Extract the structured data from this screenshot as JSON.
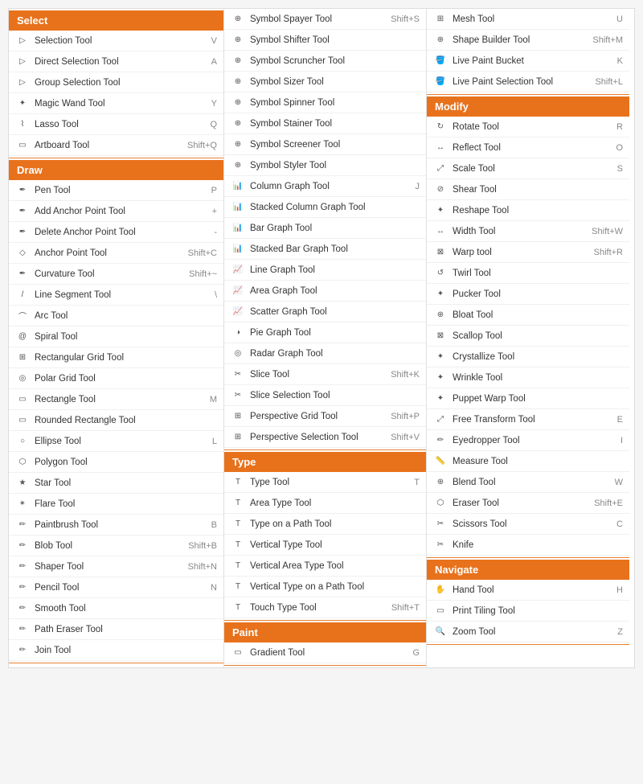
{
  "columns": [
    {
      "sections": [
        {
          "header": "Select",
          "tools": [
            {
              "name": "Selection Tool",
              "shortcut": "V",
              "icon": "▷"
            },
            {
              "name": "Direct Selection Tool",
              "shortcut": "A",
              "icon": "▷"
            },
            {
              "name": "Group Selection Tool",
              "shortcut": "",
              "icon": "▷"
            },
            {
              "name": "Magic Wand Tool",
              "shortcut": "Y",
              "icon": "✦"
            },
            {
              "name": "Lasso Tool",
              "shortcut": "Q",
              "icon": "⌇"
            },
            {
              "name": "Artboard Tool",
              "shortcut": "Shift+Q",
              "icon": "▭"
            }
          ]
        },
        {
          "header": "Draw",
          "tools": [
            {
              "name": "Pen Tool",
              "shortcut": "P",
              "icon": "✒"
            },
            {
              "name": "Add Anchor Point Tool",
              "shortcut": "+",
              "icon": "✒"
            },
            {
              "name": "Delete Anchor Point Tool",
              "shortcut": "-",
              "icon": "✒"
            },
            {
              "name": "Anchor Point Tool",
              "shortcut": "Shift+C",
              "icon": "◇"
            },
            {
              "name": "Curvature Tool",
              "shortcut": "Shift+~",
              "icon": "✒"
            },
            {
              "name": "Line Segment Tool",
              "shortcut": "\\",
              "icon": "/"
            },
            {
              "name": "Arc Tool",
              "shortcut": "",
              "icon": "⌒"
            },
            {
              "name": "Spiral Tool",
              "shortcut": "",
              "icon": "@"
            },
            {
              "name": "Rectangular Grid Tool",
              "shortcut": "",
              "icon": "⊞"
            },
            {
              "name": "Polar Grid Tool",
              "shortcut": "",
              "icon": "◎"
            },
            {
              "name": "Rectangle Tool",
              "shortcut": "M",
              "icon": "▭"
            },
            {
              "name": "Rounded Rectangle Tool",
              "shortcut": "",
              "icon": "▭"
            },
            {
              "name": "Ellipse Tool",
              "shortcut": "L",
              "icon": "○"
            },
            {
              "name": "Polygon Tool",
              "shortcut": "",
              "icon": "⬡"
            },
            {
              "name": "Star Tool",
              "shortcut": "",
              "icon": "★"
            },
            {
              "name": "Flare Tool",
              "shortcut": "",
              "icon": "✴"
            },
            {
              "name": "Paintbrush Tool",
              "shortcut": "B",
              "icon": "✏"
            },
            {
              "name": "Blob Tool",
              "shortcut": "Shift+B",
              "icon": "✏"
            },
            {
              "name": "Shaper Tool",
              "shortcut": "Shift+N",
              "icon": "✏"
            },
            {
              "name": "Pencil Tool",
              "shortcut": "N",
              "icon": "✏"
            },
            {
              "name": "Smooth Tool",
              "shortcut": "",
              "icon": "✏"
            },
            {
              "name": "Path Eraser Tool",
              "shortcut": "",
              "icon": "✏"
            },
            {
              "name": "Join Tool",
              "shortcut": "",
              "icon": "✏"
            }
          ]
        }
      ]
    },
    {
      "sections": [
        {
          "header": null,
          "tools": [
            {
              "name": "Symbol Spayer Tool",
              "shortcut": "Shift+S",
              "icon": "⊕"
            },
            {
              "name": "Symbol Shifter Tool",
              "shortcut": "",
              "icon": "⊕"
            },
            {
              "name": "Symbol Scruncher Tool",
              "shortcut": "",
              "icon": "⊕"
            },
            {
              "name": "Symbol Sizer Tool",
              "shortcut": "",
              "icon": "⊕"
            },
            {
              "name": "Symbol Spinner Tool",
              "shortcut": "",
              "icon": "⊕"
            },
            {
              "name": "Symbol Stainer Tool",
              "shortcut": "",
              "icon": "⊕"
            },
            {
              "name": "Symbol Screener Tool",
              "shortcut": "",
              "icon": "⊕"
            },
            {
              "name": "Symbol Styler Tool",
              "shortcut": "",
              "icon": "⊕"
            },
            {
              "name": "Column Graph Tool",
              "shortcut": "J",
              "icon": "📊"
            },
            {
              "name": "Stacked Column Graph Tool",
              "shortcut": "",
              "icon": "📊"
            },
            {
              "name": "Bar Graph Tool",
              "shortcut": "",
              "icon": "📊"
            },
            {
              "name": "Stacked Bar Graph Tool",
              "shortcut": "",
              "icon": "📊"
            },
            {
              "name": "Line Graph Tool",
              "shortcut": "",
              "icon": "📈"
            },
            {
              "name": "Area Graph Tool",
              "shortcut": "",
              "icon": "📈"
            },
            {
              "name": "Scatter Graph Tool",
              "shortcut": "",
              "icon": "📈"
            },
            {
              "name": "Pie Graph Tool",
              "shortcut": "",
              "icon": "◑"
            },
            {
              "name": "Radar Graph Tool",
              "shortcut": "",
              "icon": "◎"
            },
            {
              "name": "Slice Tool",
              "shortcut": "Shift+K",
              "icon": "✂"
            },
            {
              "name": "Slice Selection Tool",
              "shortcut": "",
              "icon": "✂"
            },
            {
              "name": "Perspective Grid Tool",
              "shortcut": "Shift+P",
              "icon": "⊞"
            },
            {
              "name": "Perspective Selection Tool",
              "shortcut": "Shift+V",
              "icon": "⊞"
            }
          ]
        },
        {
          "header": "Type",
          "tools": [
            {
              "name": "Type Tool",
              "shortcut": "T",
              "icon": "T"
            },
            {
              "name": "Area Type Tool",
              "shortcut": "",
              "icon": "T"
            },
            {
              "name": "Type on a Path Tool",
              "shortcut": "",
              "icon": "T"
            },
            {
              "name": "Vertical Type Tool",
              "shortcut": "",
              "icon": "T"
            },
            {
              "name": "Vertical Area Type Tool",
              "shortcut": "",
              "icon": "T"
            },
            {
              "name": "Vertical Type on a Path Tool",
              "shortcut": "",
              "icon": "T"
            },
            {
              "name": "Touch Type Tool",
              "shortcut": "Shift+T",
              "icon": "T"
            }
          ]
        },
        {
          "header": "Paint",
          "tools": [
            {
              "name": "Gradient Tool",
              "shortcut": "G",
              "icon": "▭"
            }
          ]
        }
      ]
    },
    {
      "sections": [
        {
          "header": null,
          "tools": [
            {
              "name": "Mesh Tool",
              "shortcut": "U",
              "icon": "⊞"
            },
            {
              "name": "Shape Builder Tool",
              "shortcut": "Shift+M",
              "icon": "⊕"
            },
            {
              "name": "Live Paint Bucket",
              "shortcut": "K",
              "icon": "🪣"
            },
            {
              "name": "Live Paint Selection Tool",
              "shortcut": "Shift+L",
              "icon": "🪣"
            }
          ]
        },
        {
          "header": "Modify",
          "tools": [
            {
              "name": "Rotate Tool",
              "shortcut": "R",
              "icon": "↻"
            },
            {
              "name": "Reflect Tool",
              "shortcut": "O",
              "icon": "↔"
            },
            {
              "name": "Scale Tool",
              "shortcut": "S",
              "icon": "⤢"
            },
            {
              "name": "Shear Tool",
              "shortcut": "",
              "icon": "⊘"
            },
            {
              "name": "Reshape Tool",
              "shortcut": "",
              "icon": "✦"
            },
            {
              "name": "Width Tool",
              "shortcut": "Shift+W",
              "icon": "↔"
            },
            {
              "name": "Warp tool",
              "shortcut": "Shift+R",
              "icon": "⊠"
            },
            {
              "name": "Twirl Tool",
              "shortcut": "",
              "icon": "↺"
            },
            {
              "name": "Pucker Tool",
              "shortcut": "",
              "icon": "✦"
            },
            {
              "name": "Bloat Tool",
              "shortcut": "",
              "icon": "⊕"
            },
            {
              "name": "Scallop Tool",
              "shortcut": "",
              "icon": "⊠"
            },
            {
              "name": "Crystallize Tool",
              "shortcut": "",
              "icon": "✦"
            },
            {
              "name": "Wrinkle Tool",
              "shortcut": "",
              "icon": "✦"
            },
            {
              "name": "Puppet Warp Tool",
              "shortcut": "",
              "icon": "✦"
            },
            {
              "name": "Free Transform Tool",
              "shortcut": "E",
              "icon": "⤢"
            },
            {
              "name": "Eyedropper Tool",
              "shortcut": "I",
              "icon": "✏"
            },
            {
              "name": "Measure Tool",
              "shortcut": "",
              "icon": "📏"
            },
            {
              "name": "Blend Tool",
              "shortcut": "W",
              "icon": "⊕"
            },
            {
              "name": "Eraser Tool",
              "shortcut": "Shift+E",
              "icon": "⬡"
            },
            {
              "name": "Scissors Tool",
              "shortcut": "C",
              "icon": "✂"
            },
            {
              "name": "Knife",
              "shortcut": "",
              "icon": "✂"
            }
          ]
        },
        {
          "header": "Navigate",
          "tools": [
            {
              "name": "Hand Tool",
              "shortcut": "H",
              "icon": "✋"
            },
            {
              "name": "Print Tiling Tool",
              "shortcut": "",
              "icon": "▭"
            },
            {
              "name": "Zoom Tool",
              "shortcut": "Z",
              "icon": "🔍"
            }
          ]
        }
      ]
    }
  ]
}
